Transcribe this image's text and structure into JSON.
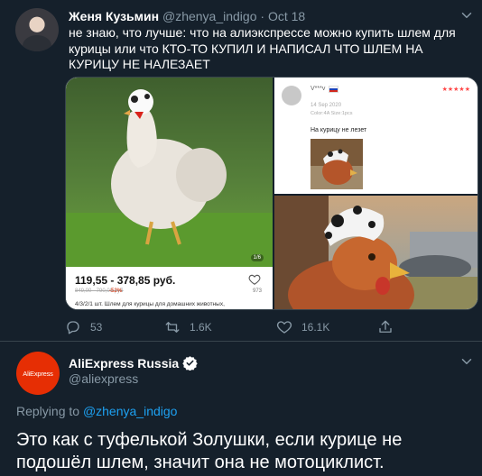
{
  "tweet": {
    "author_name": "Женя Кузьмин",
    "author_handle": "@zhenya_indigo",
    "separator": " · ",
    "date": "Oct 18",
    "text": "не знаю, что лучше: что на алиэкспрессе можно купить шлем для курицы или что КТО-ТО КУПИЛ И НАПИСАЛ ЧТО ШЛЕМ НА КУРИЦУ НЕ НАЛЕЗАЕТ",
    "media": {
      "product": {
        "price": "119,55 - 378,85 руб.",
        "old_price": "849,00 - 790,00 руб",
        "discount": "-52%",
        "likes": "973",
        "description": "4/3/2/1 шт. Шлем для курицы для домашних животных,",
        "pager": "1/6"
      },
      "review": {
        "user": "V***v",
        "stars": "★★★★★",
        "date": "14 Sep 2020",
        "meta": "Color:4A Size:1pcs",
        "text": "На курицу не лезет"
      }
    },
    "actions": {
      "reply_count": "53",
      "retweet_count": "1.6K",
      "like_count": "16.1K"
    }
  },
  "reply": {
    "avatar_text": "AliExpress",
    "author_name": "AliExpress Russia",
    "author_handle": "@aliexpress",
    "replying_prefix": "Replying to",
    "replying_to": "@zhenya_indigo",
    "text": "Это как с туфелькой Золушки, если курице не подошёл шлем, значит она не мотоциклист."
  },
  "colors": {
    "background": "#15202b",
    "secondary_text": "#8899a6",
    "link": "#1da1f2",
    "aliexpress_red": "#e62e04",
    "verified": "#ffffff"
  }
}
